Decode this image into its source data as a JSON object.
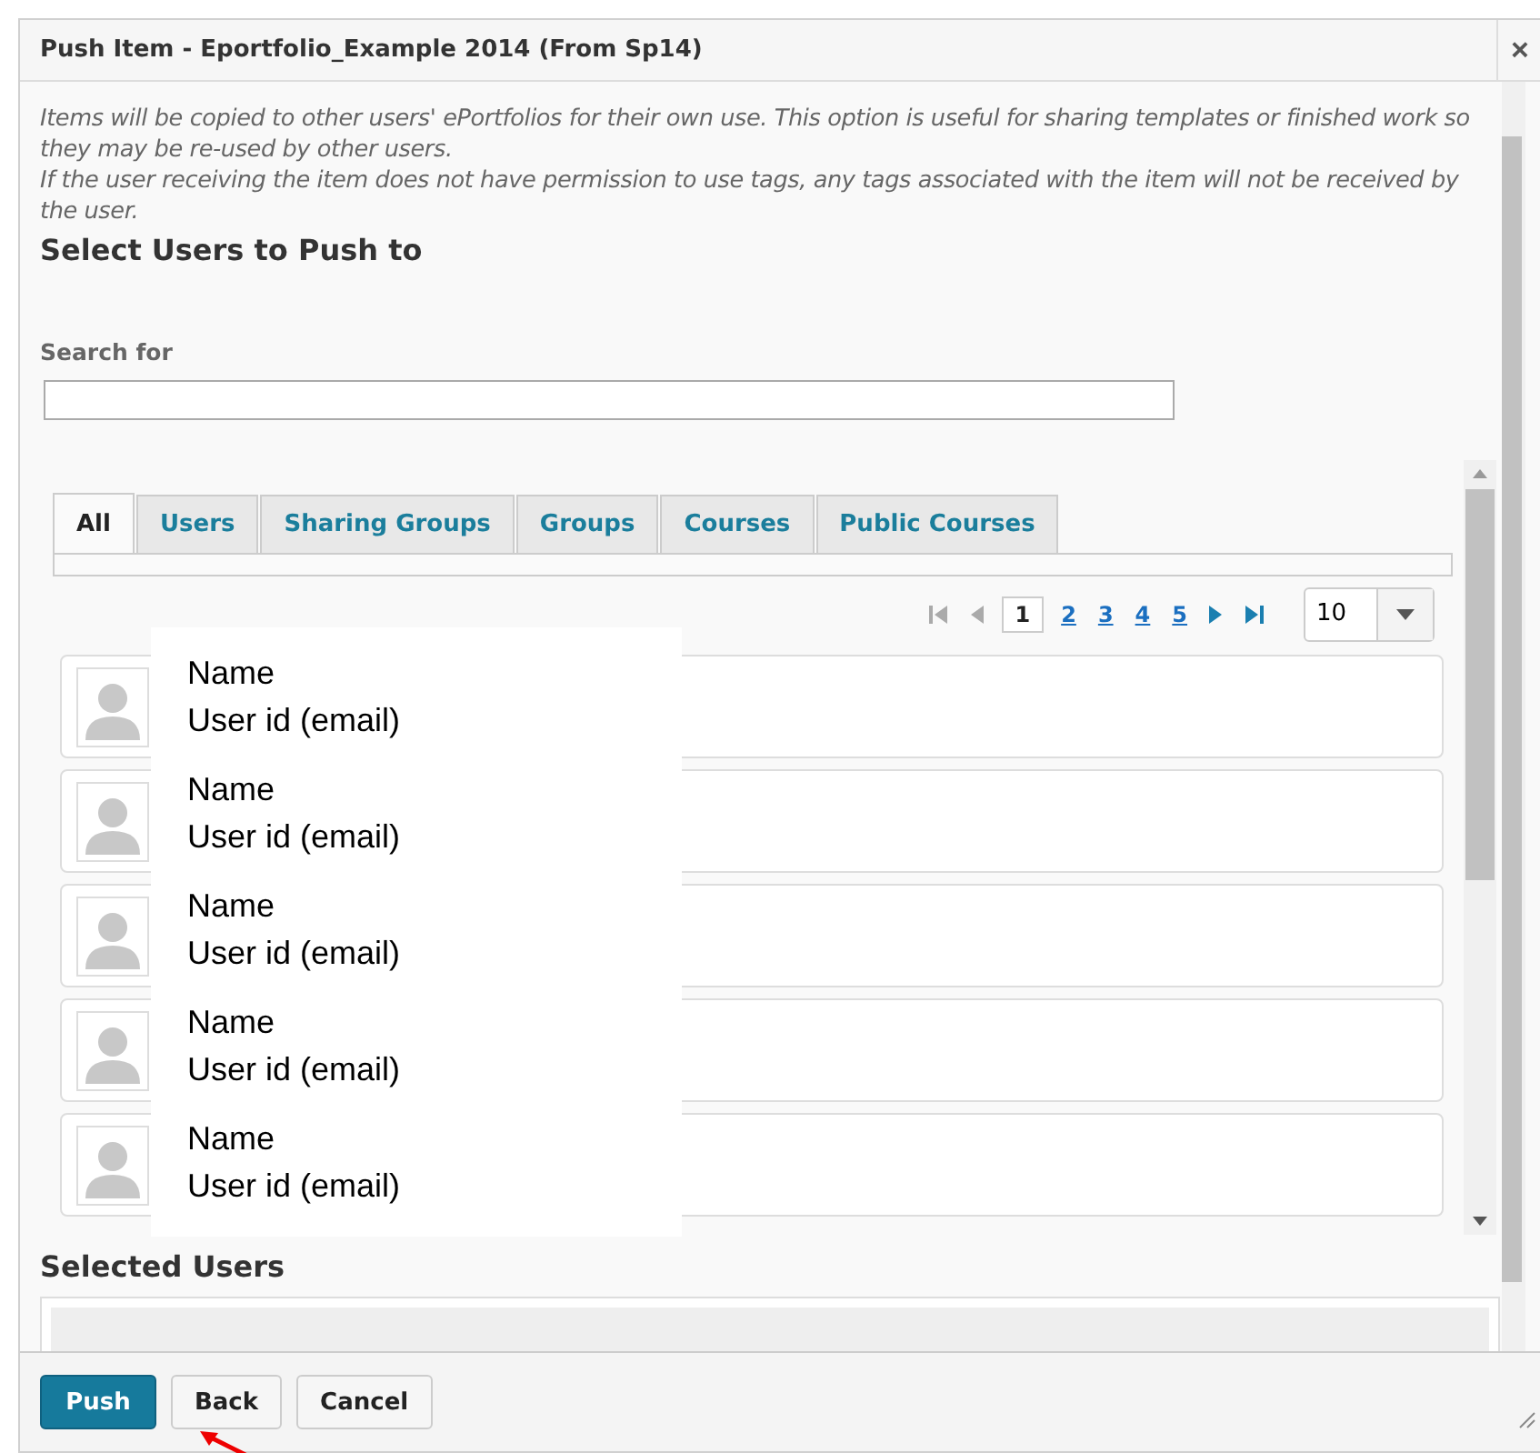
{
  "window": {
    "title": "Push Item - Eportfolio_Example 2014 (From Sp14)",
    "close": "×"
  },
  "intro": [
    "Items will be copied to other users' ePortfolios for their own use. This option is useful for sharing templates or finished work so they may be re-used by other users.",
    "If the user receiving the item does not have permission to use tags, any tags associated with the item will not be received by the user."
  ],
  "heading": "Select Users to Push to",
  "search": {
    "label": "Search for"
  },
  "tabs": [
    {
      "label": "All",
      "selected": true
    },
    {
      "label": "Users",
      "selected": false
    },
    {
      "label": "Sharing Groups",
      "selected": false
    },
    {
      "label": "Groups",
      "selected": false
    },
    {
      "label": "Courses",
      "selected": false
    },
    {
      "label": "Public Courses",
      "selected": false
    }
  ],
  "pager": {
    "pages": [
      {
        "label": "1",
        "selected": true
      },
      {
        "label": "2",
        "selected": false
      },
      {
        "label": "3",
        "selected": false
      },
      {
        "label": "4",
        "selected": false
      },
      {
        "label": "5",
        "selected": false
      }
    ],
    "page_size": "10"
  },
  "users": [
    {
      "name": "Name",
      "user_id": "User id (email)"
    },
    {
      "name": "Name",
      "user_id": "User id (email)"
    },
    {
      "name": "Name",
      "user_id": "User id (email)"
    },
    {
      "name": "Name",
      "user_id": "User id (email)"
    },
    {
      "name": "Name",
      "user_id": "User id (email)"
    }
  ],
  "selected_heading": "Selected Users",
  "buttons": [
    {
      "label": "Push",
      "kind": "primary"
    },
    {
      "label": "Back",
      "kind": "secondary"
    },
    {
      "label": "Cancel",
      "kind": "secondary"
    }
  ]
}
